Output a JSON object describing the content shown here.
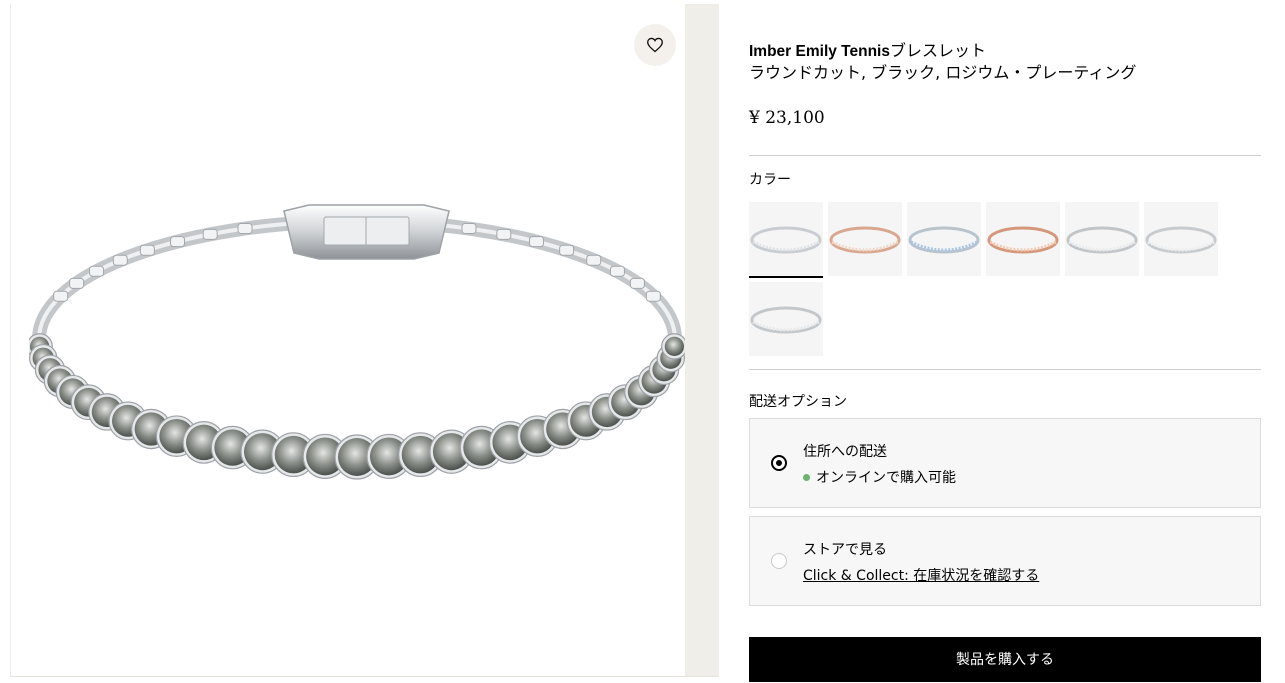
{
  "product": {
    "title_bold": "Imber Emily Tennis",
    "title_rest": "ブレスレット",
    "subtitle": "ラウンドカット, ブラック, ロジウム・プレーティング",
    "price": "¥ 23,100"
  },
  "color": {
    "label": "カラー",
    "selected_index": 0,
    "swatches": [
      {
        "tint": "#c9ccd0",
        "stone": "#dfe2e5"
      },
      {
        "tint": "#d9a78f",
        "stone": "#f0d7c8"
      },
      {
        "tint": "#b9c3cc",
        "stone": "#a9c6e3"
      },
      {
        "tint": "#d49779",
        "stone": "#f3c9b1"
      },
      {
        "tint": "#c2c5c8",
        "stone": "#e8eaec"
      },
      {
        "tint": "#c8cbce",
        "stone": "#eceeef"
      },
      {
        "tint": "#c4c7ca",
        "stone": "#e6e8ea"
      }
    ]
  },
  "delivery": {
    "label": "配送オプション",
    "options": [
      {
        "title": "住所への配送",
        "status": "オンラインで購入可能",
        "selected": true
      },
      {
        "title": "ストアで見る",
        "link": "Click & Collect: 在庫状況を確認する",
        "selected": false
      }
    ]
  },
  "buy_button": "製品を購入する",
  "icons": {
    "wishlist": "heart-icon"
  },
  "colors": {
    "accent": "#000000",
    "available_dot": "#6db36d",
    "side_strip": "#f0eee8"
  }
}
